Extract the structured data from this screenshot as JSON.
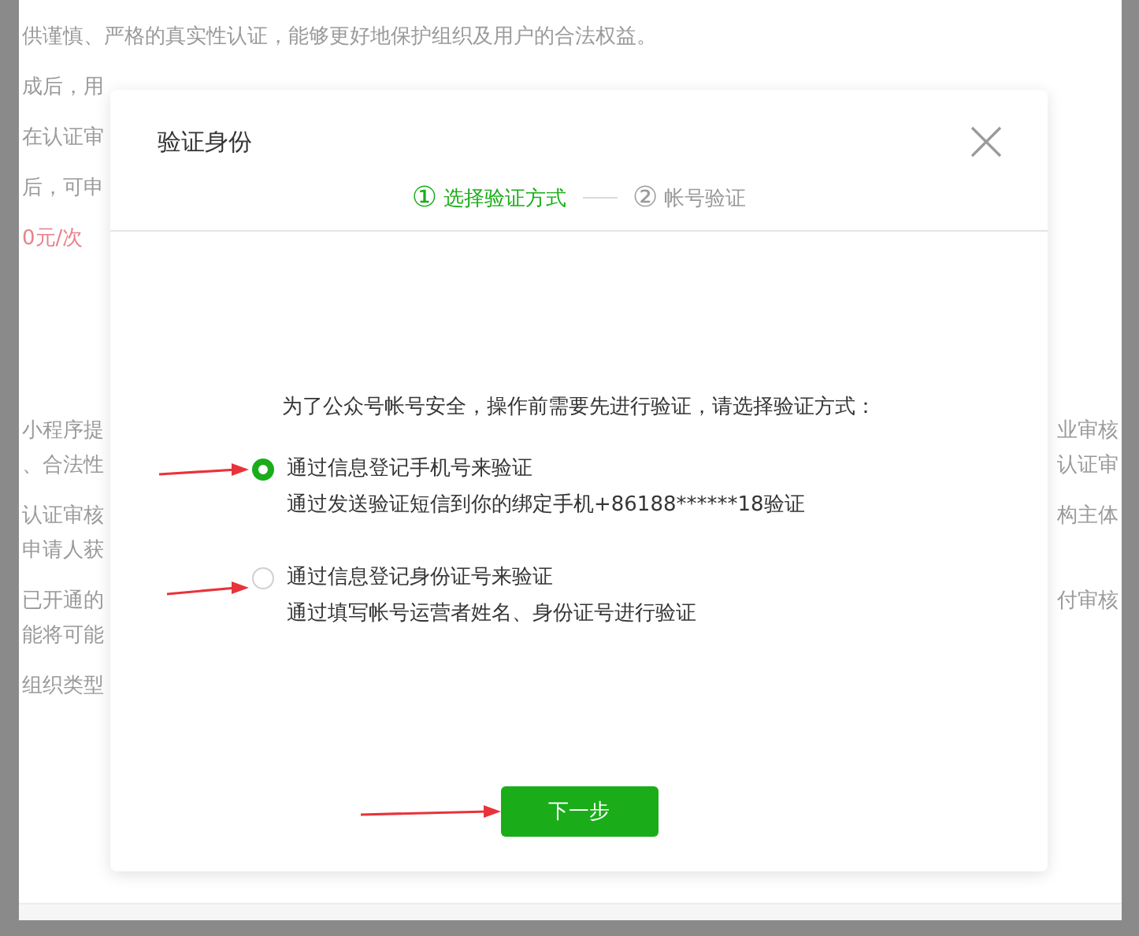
{
  "background_page": {
    "lines": [
      {
        "left": "供谨慎、严格的真实性认证，能够更好地保护组织及用户的合法权益。",
        "highlight": false
      },
      {
        "left": "成后，用",
        "highlight": false
      },
      {
        "left": "在认证审",
        "highlight": false
      },
      {
        "left": "后，可申",
        "highlight": false
      },
      {
        "left": "0元/次",
        "highlight": true
      },
      {
        "left": "小程序提",
        "right": "业审核",
        "highlight": false
      },
      {
        "left": "、合法性",
        "right": "认证审",
        "highlight": false
      },
      {
        "left": "认证审核",
        "right": "构主体",
        "highlight": false
      },
      {
        "left": "申请人获",
        "highlight": false
      },
      {
        "left": "已开通的",
        "right": "付审核",
        "highlight": false
      },
      {
        "left": "能将可能",
        "highlight": false
      },
      {
        "left": "组织类型",
        "highlight": false
      }
    ]
  },
  "dialog": {
    "title": "验证身份",
    "steps": [
      {
        "number": "①",
        "label": "选择验证方式",
        "selected": true
      },
      {
        "number": "②",
        "label": "帐号验证",
        "selected": false
      }
    ],
    "prompt": "为了公众号帐号安全，操作前需要先进行验证，请选择验证方式：",
    "options": [
      {
        "label": "通过信息登记手机号来验证",
        "description": "通过发送验证短信到你的绑定手机+86188******18验证",
        "selected": true
      },
      {
        "label": "通过信息登记身份证号来验证",
        "description": "通过填写帐号运营者姓名、身份证号进行验证",
        "selected": false
      }
    ],
    "button": "下一步"
  }
}
